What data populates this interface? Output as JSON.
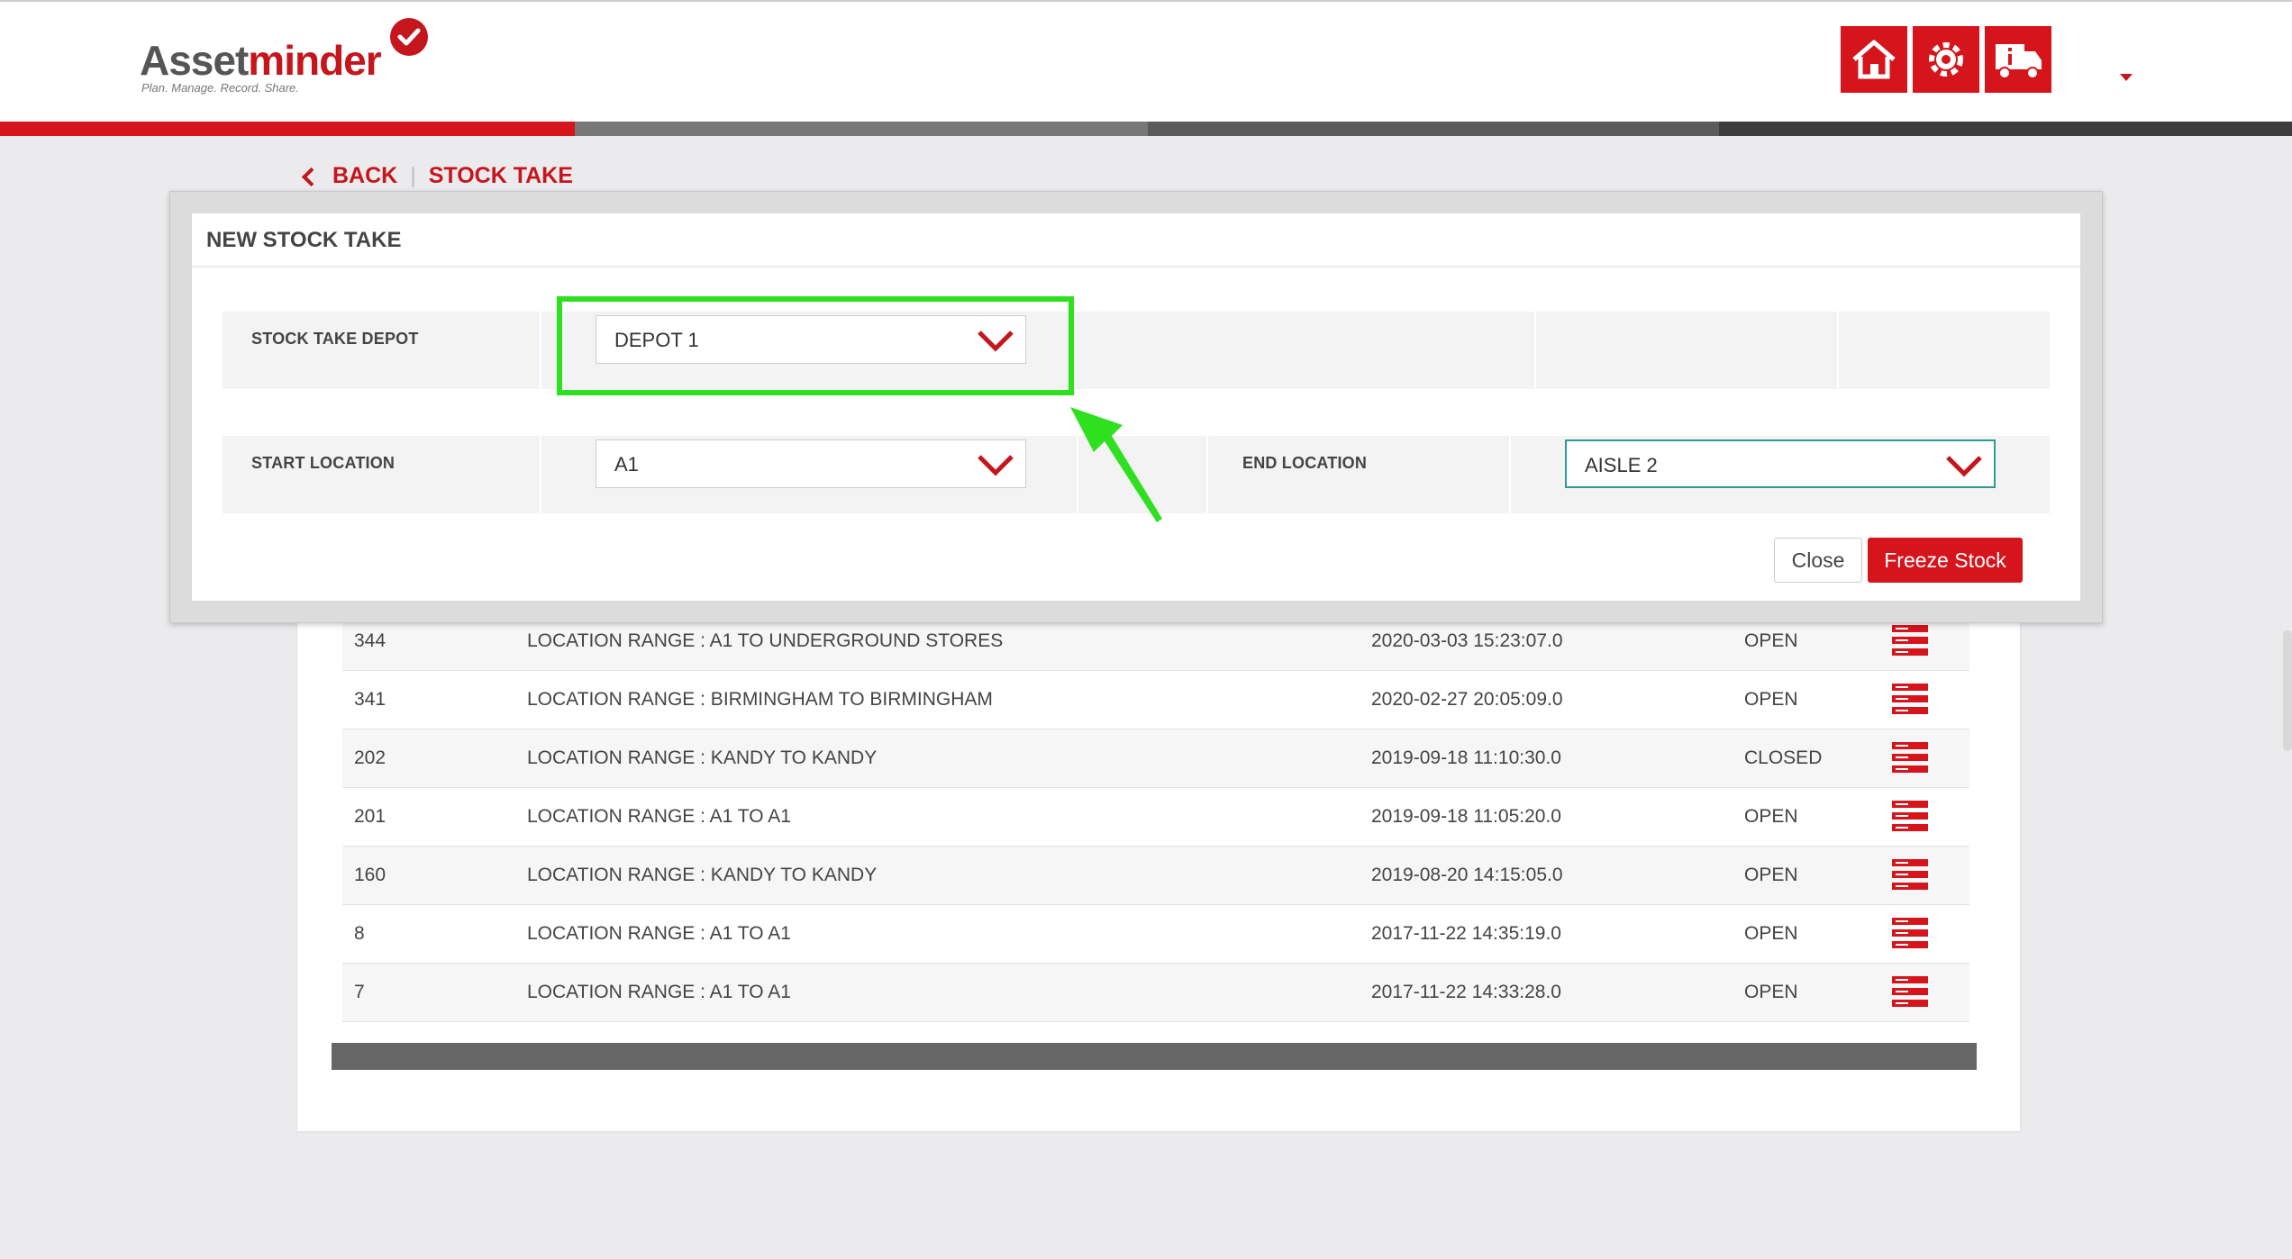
{
  "app": {
    "logo_main": "Asset",
    "logo_accent": "minder",
    "logo_tagline": "Plan. Manage. Record. Share."
  },
  "header": {
    "icons": [
      "home-icon",
      "settings-gear-icon",
      "delivery-truck-info-icon"
    ],
    "accent_color": "#d5141b"
  },
  "breadcrumb": {
    "back_label": "BACK",
    "current_label": "STOCK TAKE"
  },
  "modal": {
    "title": "NEW STOCK TAKE",
    "depot_label": "STOCK TAKE DEPOT",
    "depot_value": "DEPOT 1",
    "start_label": "START LOCATION",
    "start_value": "A1",
    "end_label": "END LOCATION",
    "end_value": "AISLE 2",
    "close_label": "Close",
    "freeze_label": "Freeze Stock"
  },
  "stock_takes": [
    {
      "id": "344",
      "description": "LOCATION RANGE : A1 TO UNDERGROUND STORES",
      "date": "2020-03-03 15:23:07.0",
      "status": "OPEN"
    },
    {
      "id": "341",
      "description": "LOCATION RANGE : BIRMINGHAM TO BIRMINGHAM",
      "date": "2020-02-27 20:05:09.0",
      "status": "OPEN"
    },
    {
      "id": "202",
      "description": "LOCATION RANGE : KANDY TO KANDY",
      "date": "2019-09-18 11:10:30.0",
      "status": "CLOSED"
    },
    {
      "id": "201",
      "description": "LOCATION RANGE : A1 TO A1",
      "date": "2019-09-18 11:05:20.0",
      "status": "OPEN"
    },
    {
      "id": "160",
      "description": "LOCATION RANGE : KANDY TO KANDY",
      "date": "2019-08-20 14:15:05.0",
      "status": "OPEN"
    },
    {
      "id": "8",
      "description": "LOCATION RANGE : A1 TO A1",
      "date": "2017-11-22 14:35:19.0",
      "status": "OPEN"
    },
    {
      "id": "7",
      "description": "LOCATION RANGE : A1 TO A1",
      "date": "2017-11-22 14:33:28.0",
      "status": "OPEN"
    }
  ],
  "colors": {
    "brand_red": "#d5141b",
    "highlight_green": "#2ee01f",
    "teal_focus": "#2a9d8f",
    "stripe": [
      "#d5141b",
      "#777777",
      "#5b5b5b",
      "#3d3d3d"
    ]
  }
}
